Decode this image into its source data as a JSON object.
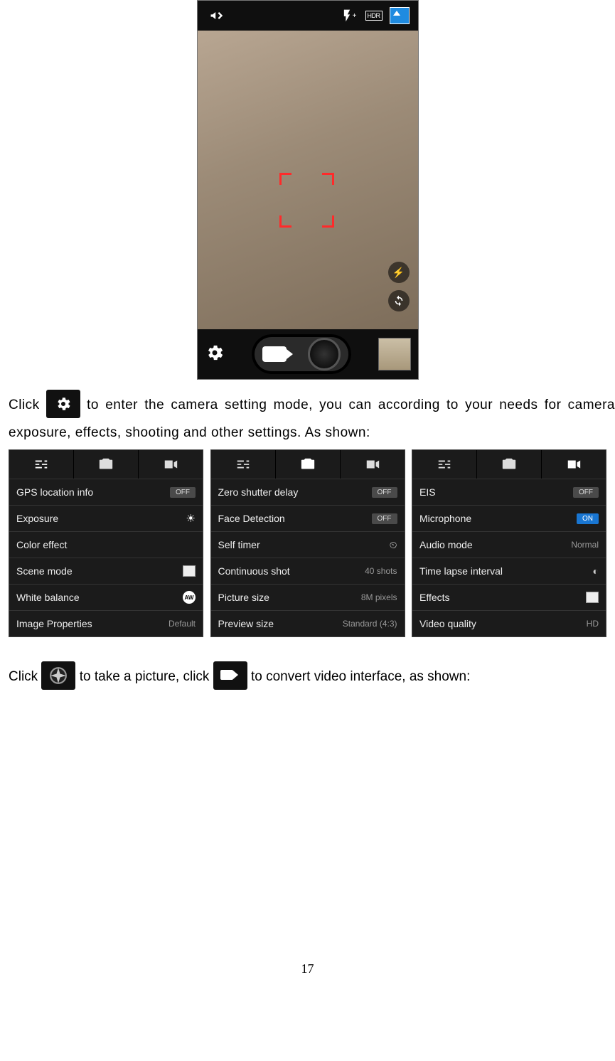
{
  "camera_top": {
    "hdr_label": "HDR"
  },
  "camera_side": {
    "flash_glyph": "⚡",
    "switch_glyph": "⟲"
  },
  "paragraph1_a": "Click ",
  "paragraph1_b": " to enter the camera setting mode, you can according to your needs for camera exposure, effects, shooting and other settings. As shown:",
  "paragraph2_a": "Click ",
  "paragraph2_b": " to take a picture, click ",
  "paragraph2_c": " to convert video interface, as shown:",
  "panels": [
    {
      "rows": [
        {
          "label": "GPS location info",
          "pill": "OFF",
          "pill_on": false
        },
        {
          "label": "Exposure",
          "icon": "sun"
        },
        {
          "label": "Color effect"
        },
        {
          "label": "Scene mode",
          "icon": "sq"
        },
        {
          "label": "White balance",
          "icon": "aw"
        },
        {
          "label": "Image Properties",
          "value": "Default"
        }
      ]
    },
    {
      "rows": [
        {
          "label": "Zero shutter delay",
          "pill": "OFF",
          "pill_on": false
        },
        {
          "label": "Face Detection",
          "pill": "OFF",
          "pill_on": false
        },
        {
          "label": "Self timer",
          "icon": "timer"
        },
        {
          "label": "Continuous shot",
          "value": "40 shots"
        },
        {
          "label": "Picture size",
          "value": "8M pixels"
        },
        {
          "label": "Preview size",
          "value": "Standard (4:3)"
        }
      ]
    },
    {
      "rows": [
        {
          "label": "EIS",
          "pill": "OFF",
          "pill_on": false
        },
        {
          "label": "Microphone",
          "pill": "ON",
          "pill_on": true
        },
        {
          "label": "Audio mode",
          "value": "Normal"
        },
        {
          "label": "Time lapse interval",
          "icon": "timer"
        },
        {
          "label": "Effects",
          "icon": "sq"
        },
        {
          "label": "Video quality",
          "value": "HD"
        }
      ]
    }
  ],
  "page_number": "17"
}
